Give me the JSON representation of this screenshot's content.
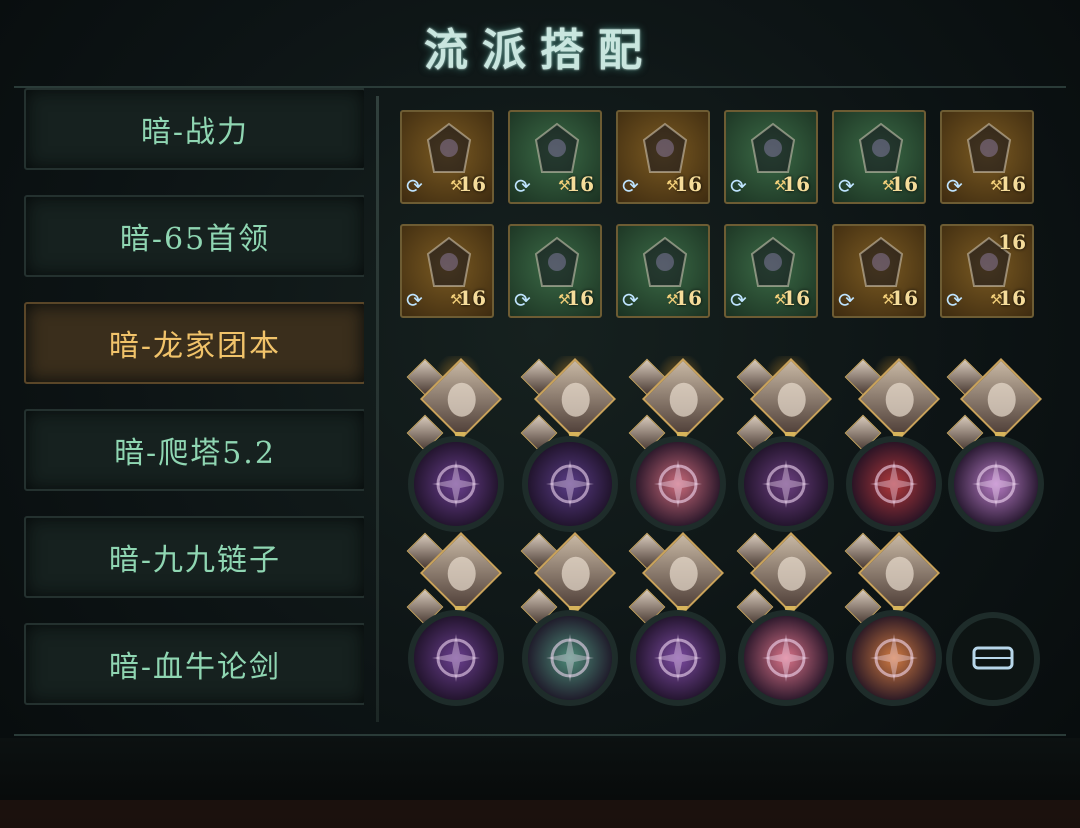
{
  "title": "流派搭配",
  "sidebar": {
    "items": [
      {
        "label": "暗-战力",
        "active": false
      },
      {
        "label": "暗-65首领",
        "active": false
      },
      {
        "label": "暗-龙家团本",
        "active": true
      },
      {
        "label": "暗-爬塔5.2",
        "active": false
      },
      {
        "label": "暗-九九链子",
        "active": false
      },
      {
        "label": "暗-血牛论剑",
        "active": false
      }
    ]
  },
  "equipment": {
    "rows": [
      [
        {
          "level": "16",
          "bg": "gold",
          "art": "golden-fan-weapon"
        },
        {
          "level": "16",
          "bg": "green",
          "art": "silver-gauntlet"
        },
        {
          "level": "16",
          "bg": "gold",
          "art": "dark-armor"
        },
        {
          "level": "16",
          "bg": "green",
          "art": "purple-robe"
        },
        {
          "level": "16",
          "bg": "green",
          "art": "steel-boots"
        },
        {
          "level": "16",
          "bg": "gold",
          "art": "red-necklace"
        }
      ],
      [
        {
          "level": "16",
          "bg": "gold",
          "art": "purple-flame-charm"
        },
        {
          "level": "16",
          "bg": "green",
          "art": "shadow-cloak"
        },
        {
          "level": "16",
          "bg": "green",
          "art": "crystal-bracer"
        },
        {
          "level": "16",
          "bg": "green",
          "art": "blue-belt"
        },
        {
          "level": "16",
          "bg": "gold",
          "art": "crimson-ornament"
        },
        {
          "level": "16",
          "level2": "16",
          "bg": "gold",
          "art": "rings-pair"
        }
      ]
    ]
  },
  "skills": {
    "rows": [
      [
        {
          "color": "#6a3f8e",
          "glow": true
        },
        {
          "color": "#5a3c86",
          "glow": true
        },
        {
          "color": "#c96a7a",
          "glow": true
        },
        {
          "color": "#6b3f80",
          "glow": true
        },
        {
          "color": "#b0383c",
          "glow": true
        },
        {
          "color": "#b67bc4",
          "glow": false
        }
      ],
      [
        {
          "color": "#6a3f8e",
          "glow": false
        },
        {
          "color": "#4d8a78",
          "glow": false
        },
        {
          "color": "#7b4aa0",
          "glow": false
        },
        {
          "color": "#d87288",
          "glow": false
        },
        {
          "color": "#d07a42",
          "glow": false
        }
      ]
    ],
    "empty_slot_icon": "empty-belt-icon"
  }
}
